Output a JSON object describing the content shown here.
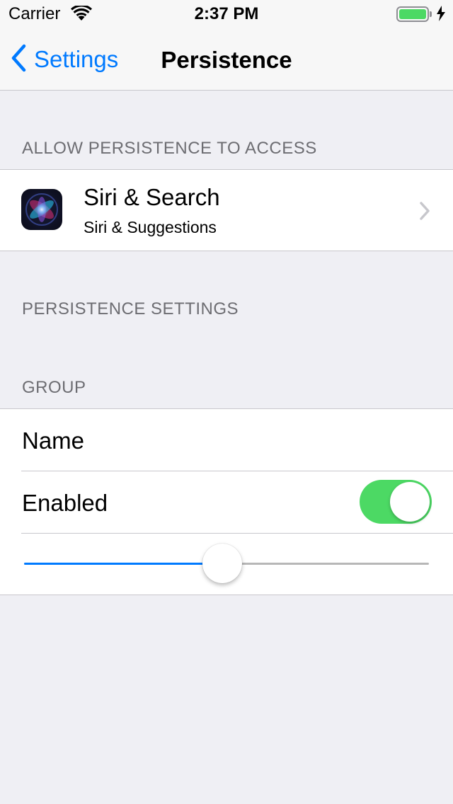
{
  "status_bar": {
    "carrier": "Carrier",
    "time": "2:37 PM",
    "battery_level": 1.0
  },
  "nav": {
    "back_label": "Settings",
    "title": "Persistence"
  },
  "sections": {
    "access_header": "ALLOW PERSISTENCE TO ACCESS",
    "settings_header": "PERSISTENCE SETTINGS",
    "group_header": "GROUP"
  },
  "siri": {
    "title": "Siri & Search",
    "subtitle": "Siri & Suggestions",
    "icon": "siri-icon"
  },
  "group": {
    "name_label": "Name",
    "enabled_label": "Enabled",
    "enabled_on": true,
    "slider_value": 0.5
  },
  "colors": {
    "accent": "#007aff",
    "toggle_on": "#4cd964",
    "background": "#efeff4",
    "section_text": "#6d6d72"
  }
}
